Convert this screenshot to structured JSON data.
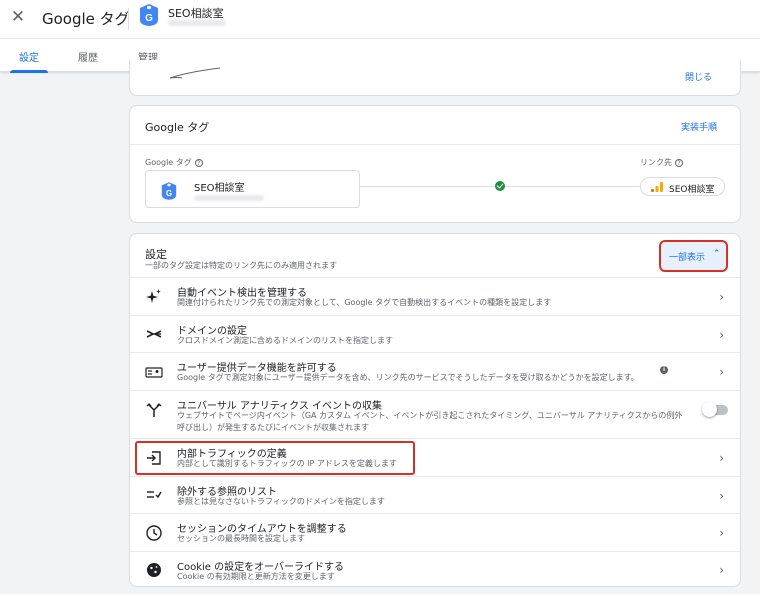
{
  "header": {
    "close_icon": "close-icon",
    "title": "Google タグ",
    "account_name": "SEO相談室",
    "badge_letter": "G"
  },
  "tabs": [
    {
      "label": "設定",
      "active": true
    },
    {
      "label": "履歴",
      "active": false
    },
    {
      "label": "管理",
      "active": false
    }
  ],
  "top_card": {
    "close_label": "閉じる"
  },
  "google_tag_card": {
    "title": "Google タグ",
    "setup_link": "実装手順",
    "tag_label": "Google タグ",
    "tag_name": "SEO相談室",
    "badge_letter": "G",
    "destination_label": "リンク先",
    "destination_name": "SEO相談室"
  },
  "settings": {
    "title": "設定",
    "subtitle": "一部のタグ設定は特定のリンク先にのみ適用されます",
    "show_less_label": "一部表示",
    "items": [
      {
        "icon": "sparkle-icon",
        "title": "自動イベント検出を管理する",
        "desc": [
          "関連付けられたリンク先での測定対象として、Google タグで自動検出するイベントの種類を設定します"
        ],
        "control": "chevron"
      },
      {
        "icon": "cross-domain-icon",
        "title": "ドメインの設定",
        "desc": [
          "クロスドメイン測定に含めるドメインのリストを指定します"
        ],
        "control": "chevron"
      },
      {
        "icon": "user-data-icon",
        "title": "ユーザー提供データ機能を許可する",
        "desc": [
          "Google タグで測定対象にユーザー提供データを含め、リンク先のサービスでそうしたデータを受け取るかどうかを設定します。"
        ],
        "control": "chevron",
        "info": true
      },
      {
        "icon": "merge-icon",
        "title": "ユニバーサル アナリティクス イベントの収集",
        "desc": [
          "ウェブサイトでページ内イベント（GA カスタム イベント、イベントが引き起こされたタイミング、ユニバーサル アナリティクスからの例外",
          "呼び出し）が発生するたびにイベントが収集されます"
        ],
        "control": "toggle",
        "toggle_on": false
      },
      {
        "icon": "enter-icon",
        "title": "内部トラフィックの定義",
        "desc": [
          "内部として識別するトラフィックの IP アドレスを定義します"
        ],
        "control": "chevron",
        "highlighted": true
      },
      {
        "icon": "exclude-list-icon",
        "title": "除外する参照のリスト",
        "desc": [
          "参照とは見なさないトラフィックのドメインを指定します"
        ],
        "control": "chevron"
      },
      {
        "icon": "clock-icon",
        "title": "セッションのタイムアウトを調整する",
        "desc": [
          "セッションの最長時間を設定します"
        ],
        "control": "chevron"
      },
      {
        "icon": "cookie-icon",
        "title": "Cookie の設定をオーバーライドする",
        "desc": [
          "Cookie の有効期限と更新方法を変更します"
        ],
        "control": "chevron"
      }
    ]
  },
  "colors": {
    "accent": "#1a73e8",
    "highlight": "#d93025",
    "success": "#1e8e3e",
    "tag_blue": "#4285f4"
  }
}
